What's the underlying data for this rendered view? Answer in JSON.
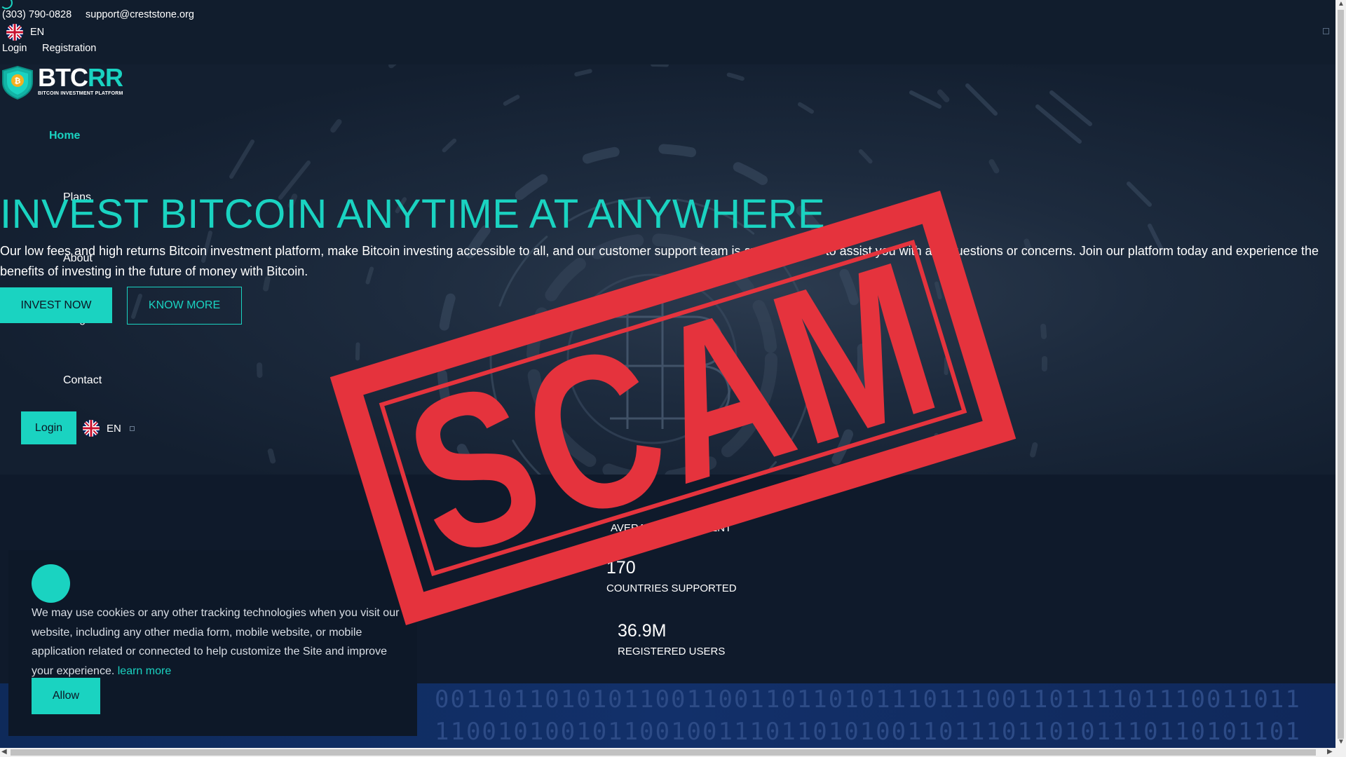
{
  "topbar": {
    "phone": "(303) 790-0828",
    "email": "support@creststone.org",
    "language": "EN",
    "login": "Login",
    "registration": "Registration"
  },
  "brand": {
    "name_part1": "BTC",
    "name_part2": "RR",
    "tagline": "BITCOIN INVESTMENT PLATFORM",
    "logo_icon": "bitcoin-shield-icon"
  },
  "nav": {
    "items": [
      "Home",
      "Plans",
      "About",
      "Blogs",
      "Contact"
    ],
    "login_button": "Login",
    "language": "EN"
  },
  "hero": {
    "title": "INVEST BITCOIN ANYTIME AT ANYWHERE",
    "description": "Our low fees and high returns Bitcoin investment platform, make Bitcoin investing accessible to all, and our customer support team is available 24/7 to assist you with any questions or concerns. Join our platform today and experience the benefits of investing in the future of money with Bitcoin.",
    "invest_button": "INVEST NOW",
    "know_more_button": "KNOW MORE"
  },
  "stats": [
    {
      "value": "",
      "label": "AVERAGE INVESTMENT"
    },
    {
      "value": "170",
      "label": "COUNTRIES SUPPORTED"
    },
    {
      "value": "36.9M",
      "label": "REGISTERED USERS"
    }
  ],
  "binary_rows": [
    "0011011010101100110011011010111011100110111101110011011",
    "1100101001011001001110110101001101110110101110110101101"
  ],
  "cookie": {
    "text": "We may use cookies or any other tracking technologies when you visit our website, including any other media form, mobile website, or mobile application related or connected to help customize the Site and improve your experience.",
    "learn_more": "learn more",
    "allow_button": "Allow"
  },
  "overlay": {
    "stamp_text": "SCAM"
  },
  "colors": {
    "accent": "#1ad3c1",
    "stamp": "#e5333d",
    "background": "#0e1a2b"
  }
}
